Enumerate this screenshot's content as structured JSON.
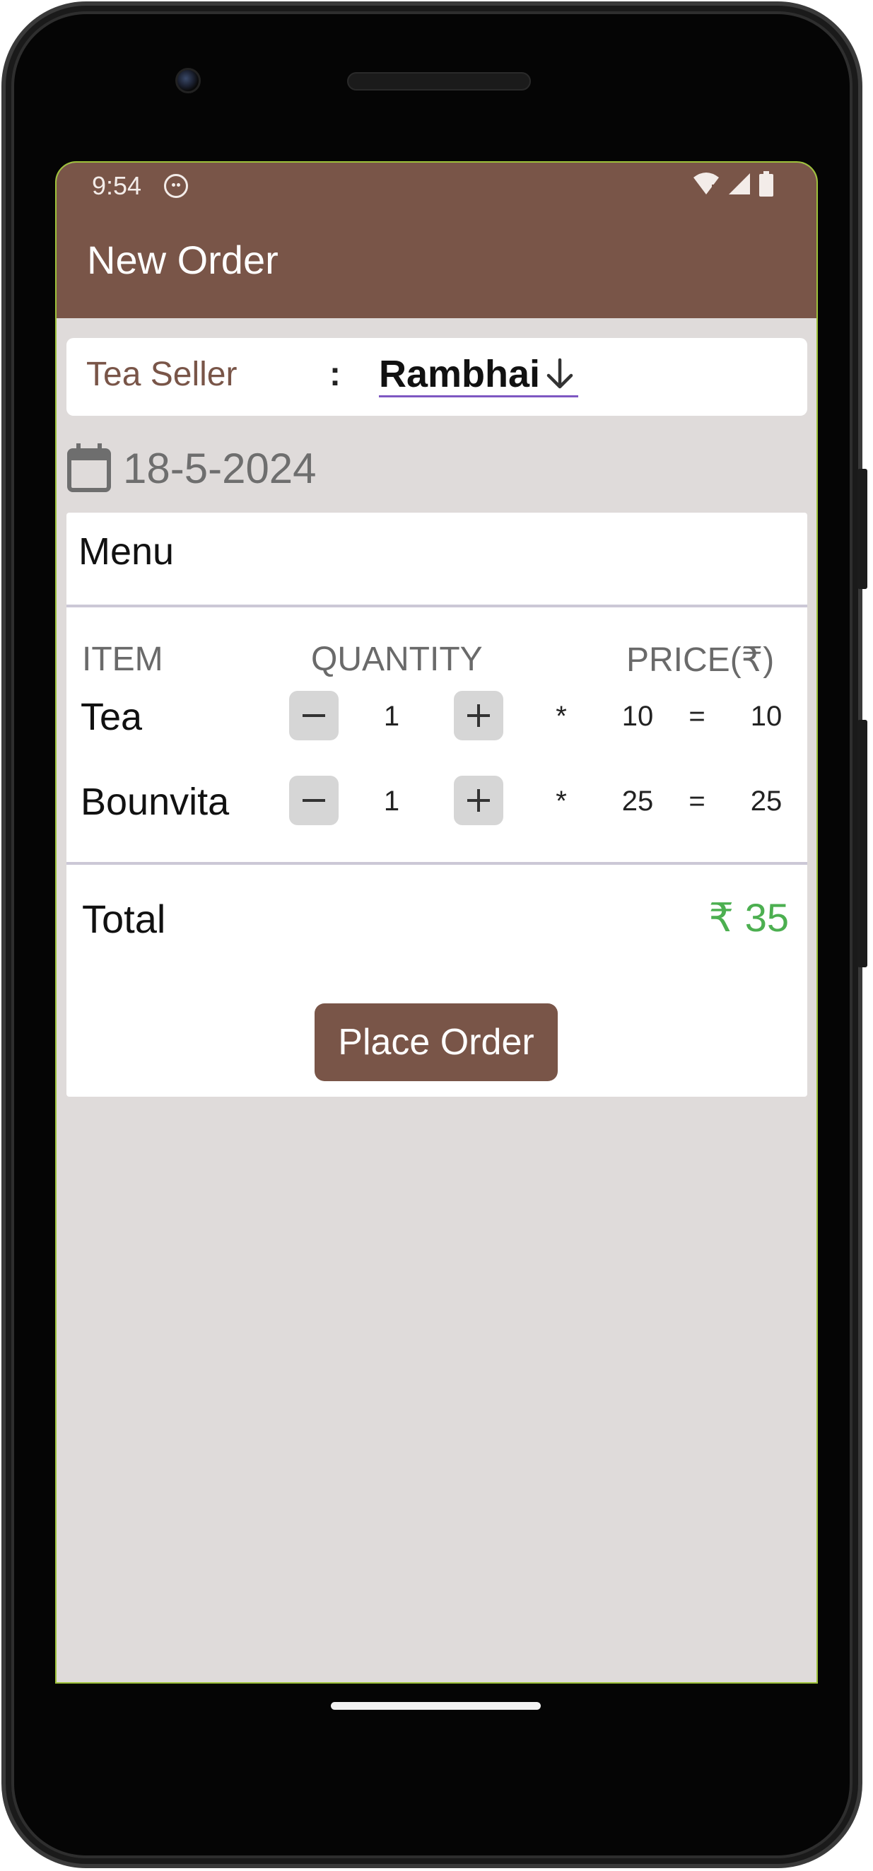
{
  "status_bar": {
    "time": "9:54"
  },
  "app_bar": {
    "title": "New Order"
  },
  "seller": {
    "label": "Tea Seller",
    "separator": ":",
    "value": "Rambhai"
  },
  "date": {
    "value": "18-5-2024"
  },
  "menu": {
    "title": "Menu",
    "headers": {
      "item": "ITEM",
      "quantity": "QUANTITY",
      "price": "PRICE(₹)"
    },
    "items": [
      {
        "name": "Tea",
        "quantity": "1",
        "multiply": "*",
        "unit_price": "10",
        "equals": "=",
        "line_total": "10"
      },
      {
        "name": "Bounvita",
        "quantity": "1",
        "multiply": "*",
        "unit_price": "25",
        "equals": "=",
        "line_total": "25"
      }
    ],
    "total_label": "Total",
    "total_value": "₹ 35",
    "place_order_label": "Place Order"
  },
  "colors": {
    "primary": "#795548",
    "background": "#dfdbda",
    "total": "#4caf50",
    "underline": "#7e57c2"
  }
}
